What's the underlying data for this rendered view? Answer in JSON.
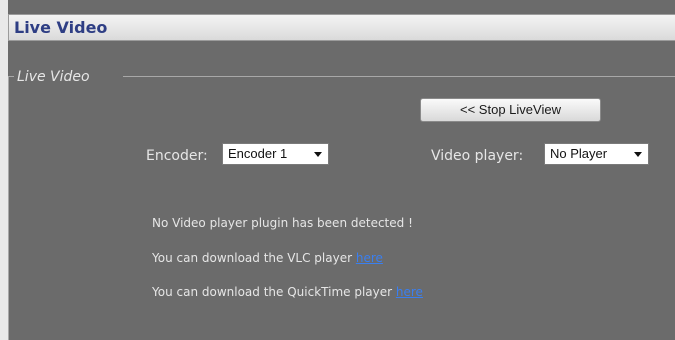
{
  "header": {
    "title": "Live Video"
  },
  "fieldset": {
    "legend": "Live Video"
  },
  "controls": {
    "stop_button_label": "<< Stop LiveView",
    "encoder_label": "Encoder:",
    "encoder_value": "Encoder 1",
    "player_label": "Video player:",
    "player_value": "No Player"
  },
  "messages": {
    "no_plugin": "No Video player plugin has been detected !",
    "vlc_text": "You can download the VLC player ",
    "vlc_link": "here",
    "quicktime_text": "You can download the QuickTime player ",
    "quicktime_link": "here"
  },
  "colors": {
    "background": "#6b6b6b",
    "header_title": "#2e3e84",
    "link": "#3a7ff0"
  },
  "icons": {
    "select_arrow": "chevron-down-icon"
  }
}
